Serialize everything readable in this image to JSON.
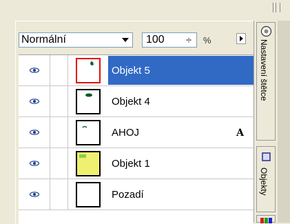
{
  "toolbar": {
    "blend_mode": "Normální",
    "opacity": "100",
    "opacity_spinner": "÷",
    "opacity_unit": "%"
  },
  "layers": [
    {
      "name": "Objekt 5",
      "selected": true,
      "thumb": "objekt5"
    },
    {
      "name": "Objekt 4",
      "selected": false,
      "thumb": "objekt4"
    },
    {
      "name": "AHOJ",
      "selected": false,
      "thumb": "ahoj",
      "badge": "A"
    },
    {
      "name": "Objekt 1",
      "selected": false,
      "thumb": "objekt1"
    },
    {
      "name": "Pozadí",
      "selected": false,
      "thumb": "pozadi"
    }
  ],
  "side_tabs": {
    "brush": "Nastavení štětce",
    "objects": "Objekty"
  },
  "colors": {
    "selection": "#316ac5",
    "selected_thumb_border": "#e01010",
    "panel_bg": "#ece9d8"
  }
}
